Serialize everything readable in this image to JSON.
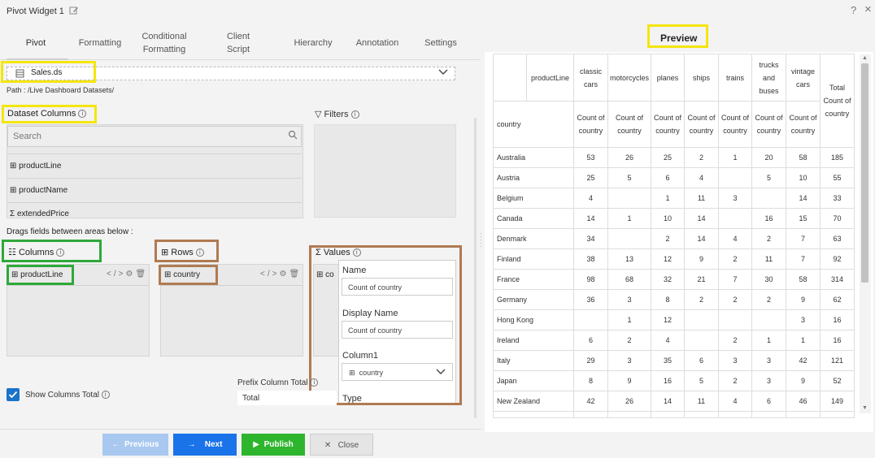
{
  "window": {
    "title": "Pivot Widget 1",
    "help": "?",
    "close": "×"
  },
  "tabs": [
    {
      "line1": "Pivot",
      "line2": ""
    },
    {
      "line1": "Formatting",
      "line2": ""
    },
    {
      "line1": "Conditional",
      "line2": "Formatting"
    },
    {
      "line1": "Client",
      "line2": "Script"
    },
    {
      "line1": "Hierarchy",
      "line2": ""
    },
    {
      "line1": "Annotation",
      "line2": ""
    },
    {
      "line1": "Settings",
      "line2": ""
    }
  ],
  "dataset": {
    "name": "Sales.ds",
    "path": "Path : /Live Dashboard Datasets/"
  },
  "dataset_columns": {
    "label": "Dataset Columns",
    "search_placeholder": "Search",
    "items": [
      {
        "label": "productLine",
        "icon": "table-icon"
      },
      {
        "label": "productName",
        "icon": "table-icon"
      },
      {
        "label": "extendedPrice",
        "icon": "sigma-icon"
      }
    ]
  },
  "filters": {
    "label": "Filters"
  },
  "drag_hint": "Drags fields between areas below :",
  "columns_area": {
    "label": "Columns",
    "item": "productLine"
  },
  "rows_area": {
    "label": "Rows",
    "item": "country"
  },
  "values_area": {
    "label": "Values",
    "item_partial": "co",
    "popup": {
      "name_label": "Name",
      "name_value": "Count of country",
      "display_label": "Display Name",
      "display_value": "Count of country",
      "column_label": "Column1",
      "column_value": "country",
      "type_label": "Type"
    }
  },
  "show_columns_total": {
    "label": "Show Columns Total",
    "checked": true
  },
  "prefix_column_total": {
    "label": "Prefix Column Total",
    "value": "Total"
  },
  "buttons": {
    "previous": "Previous",
    "next": "Next",
    "publish": "Publish",
    "close": "Close"
  },
  "preview": {
    "title": "Preview",
    "header_row1": {
      "label": "productLine",
      "columns": [
        "classic cars",
        "motorcycles",
        "planes",
        "ships",
        "trains",
        "trucks and buses",
        "vintage cars"
      ],
      "total": "Total Count of country"
    },
    "header_row2": {
      "label": "country",
      "measures": [
        "Count of country",
        "Count of country",
        "Count of country",
        "Count of country",
        "Count of country",
        "Count of country",
        "Count of country"
      ]
    },
    "rows": [
      {
        "country": "Australia",
        "values": [
          "53",
          "26",
          "25",
          "2",
          "1",
          "20",
          "58"
        ],
        "total": "185"
      },
      {
        "country": "Austria",
        "values": [
          "25",
          "5",
          "6",
          "4",
          "",
          "5",
          "10"
        ],
        "total": "55"
      },
      {
        "country": "Belgium",
        "values": [
          "4",
          "",
          "1",
          "11",
          "3",
          "",
          "14"
        ],
        "total": "33"
      },
      {
        "country": "Canada",
        "values": [
          "14",
          "1",
          "10",
          "14",
          "",
          "16",
          "15"
        ],
        "total": "70"
      },
      {
        "country": "Denmark",
        "values": [
          "34",
          "",
          "2",
          "14",
          "4",
          "2",
          "7"
        ],
        "total": "63"
      },
      {
        "country": "Finland",
        "values": [
          "38",
          "13",
          "12",
          "9",
          "2",
          "11",
          "7"
        ],
        "total": "92"
      },
      {
        "country": "France",
        "values": [
          "98",
          "68",
          "32",
          "21",
          "7",
          "30",
          "58"
        ],
        "total": "314"
      },
      {
        "country": "Germany",
        "values": [
          "36",
          "3",
          "8",
          "2",
          "2",
          "2",
          "9"
        ],
        "total": "62"
      },
      {
        "country": "Hong Kong",
        "values": [
          "",
          "1",
          "12",
          "",
          "",
          "",
          "3"
        ],
        "total": "16"
      },
      {
        "country": "Ireland",
        "values": [
          "6",
          "2",
          "4",
          "",
          "2",
          "1",
          "1"
        ],
        "total": "16"
      },
      {
        "country": "Italy",
        "values": [
          "29",
          "3",
          "35",
          "6",
          "3",
          "3",
          "42"
        ],
        "total": "121"
      },
      {
        "country": "Japan",
        "values": [
          "8",
          "9",
          "16",
          "5",
          "2",
          "3",
          "9"
        ],
        "total": "52"
      },
      {
        "country": "New Zealand",
        "values": [
          "42",
          "26",
          "14",
          "11",
          "4",
          "6",
          "46"
        ],
        "total": "149"
      }
    ]
  },
  "colors": {
    "accent": "#1a73e8",
    "publish": "#2eb52e",
    "highlight_yellow": "#f4e60c",
    "highlight_green": "#2ea83a",
    "highlight_brown": "#b07a52"
  }
}
